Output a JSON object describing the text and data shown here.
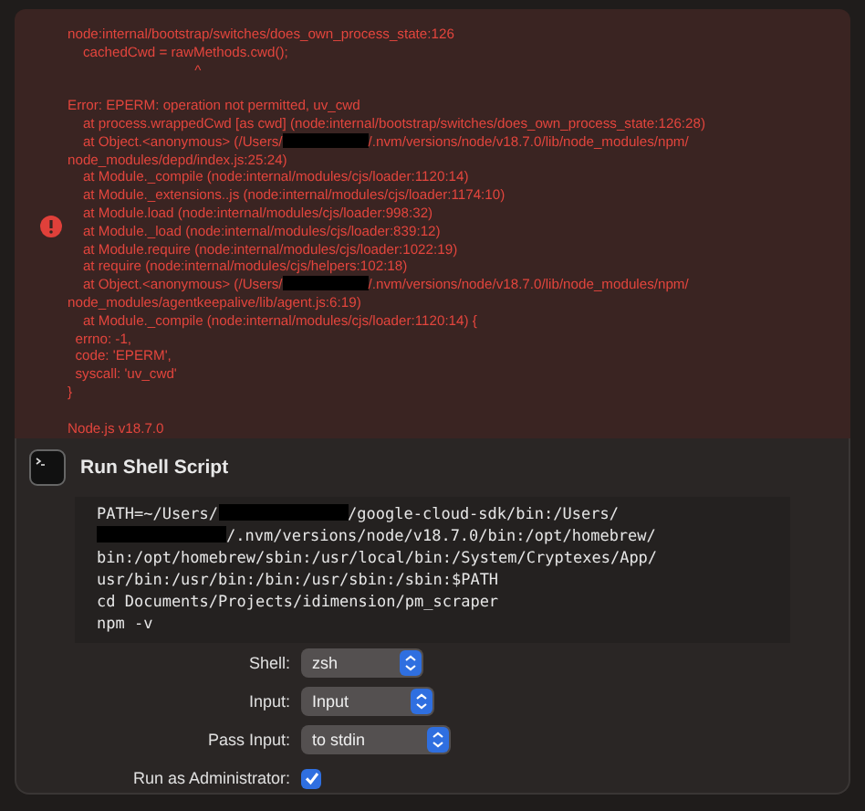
{
  "error_output": {
    "lines": [
      {
        "kind": "text",
        "parts": [
          {
            "kind": "text",
            "text": "node:internal/bootstrap/switches/does_own_process_state:126"
          }
        ]
      },
      {
        "kind": "text",
        "parts": [
          {
            "kind": "text",
            "text": "    cachedCwd = rawMethods.cwd();"
          }
        ]
      },
      {
        "kind": "text",
        "parts": [
          {
            "kind": "text",
            "text": "                                 ^"
          }
        ]
      },
      {
        "kind": "blank"
      },
      {
        "kind": "text",
        "parts": [
          {
            "kind": "text",
            "text": "Error: EPERM: operation not permitted, uv_cwd"
          }
        ]
      },
      {
        "kind": "text",
        "parts": [
          {
            "kind": "text",
            "text": "    at process.wrappedCwd [as cwd] (node:internal/bootstrap/switches/does_own_process_state:126:28)"
          }
        ]
      },
      {
        "kind": "text",
        "parts": [
          {
            "kind": "text",
            "text": "    at Object.<anonymous> (/Users/"
          },
          {
            "kind": "redacted"
          },
          {
            "kind": "text",
            "text": "/.nvm/versions/node/v18.7.0/lib/node_modules/npm/"
          }
        ]
      },
      {
        "kind": "text",
        "parts": [
          {
            "kind": "text",
            "text": "node_modules/depd/index.js:25:24)"
          }
        ]
      },
      {
        "kind": "text",
        "parts": [
          {
            "kind": "text",
            "text": "    at Module._compile (node:internal/modules/cjs/loader:1120:14)"
          }
        ]
      },
      {
        "kind": "text",
        "parts": [
          {
            "kind": "text",
            "text": "    at Module._extensions..js (node:internal/modules/cjs/loader:1174:10)"
          }
        ]
      },
      {
        "kind": "text",
        "parts": [
          {
            "kind": "text",
            "text": "    at Module.load (node:internal/modules/cjs/loader:998:32)"
          }
        ]
      },
      {
        "kind": "text",
        "parts": [
          {
            "kind": "text",
            "text": "    at Module._load (node:internal/modules/cjs/loader:839:12)"
          }
        ]
      },
      {
        "kind": "text",
        "parts": [
          {
            "kind": "text",
            "text": "    at Module.require (node:internal/modules/cjs/loader:1022:19)"
          }
        ]
      },
      {
        "kind": "text",
        "parts": [
          {
            "kind": "text",
            "text": "    at require (node:internal/modules/cjs/helpers:102:18)"
          }
        ]
      },
      {
        "kind": "text",
        "parts": [
          {
            "kind": "text",
            "text": "    at Object.<anonymous> (/Users/"
          },
          {
            "kind": "redacted"
          },
          {
            "kind": "text",
            "text": "/.nvm/versions/node/v18.7.0/lib/node_modules/npm/"
          }
        ]
      },
      {
        "kind": "text",
        "parts": [
          {
            "kind": "text",
            "text": "node_modules/agentkeepalive/lib/agent.js:6:19)"
          }
        ]
      },
      {
        "kind": "text",
        "parts": [
          {
            "kind": "text",
            "text": "    at Module._compile (node:internal/modules/cjs/loader:1120:14) {"
          }
        ]
      },
      {
        "kind": "text",
        "parts": [
          {
            "kind": "text",
            "text": "  errno: -1,"
          }
        ]
      },
      {
        "kind": "text",
        "parts": [
          {
            "kind": "text",
            "text": "  code: 'EPERM',"
          }
        ]
      },
      {
        "kind": "text",
        "parts": [
          {
            "kind": "text",
            "text": "  syscall: 'uv_cwd'"
          }
        ]
      },
      {
        "kind": "text",
        "parts": [
          {
            "kind": "text",
            "text": "}"
          }
        ]
      },
      {
        "kind": "blank"
      },
      {
        "kind": "text",
        "parts": [
          {
            "kind": "text",
            "text": "Node.js v18.7.0"
          }
        ]
      }
    ]
  },
  "action": {
    "title": "Run Shell Script",
    "script_lines": [
      [
        {
          "kind": "text",
          "text": "PATH=~/Users/"
        },
        {
          "kind": "redacted"
        },
        {
          "kind": "text",
          "text": "/google-cloud-sdk/bin:/Users/"
        }
      ],
      [
        {
          "kind": "redacted"
        },
        {
          "kind": "text",
          "text": "/.nvm/versions/node/v18.7.0/bin:/opt/homebrew/"
        }
      ],
      [
        {
          "kind": "text",
          "text": "bin:/opt/homebrew/sbin:/usr/local/bin:/System/Cryptexes/App/"
        }
      ],
      [
        {
          "kind": "text",
          "text": "usr/bin:/usr/bin:/bin:/usr/sbin:/sbin:$PATH"
        }
      ],
      [
        {
          "kind": "text",
          "text": "cd Documents/Projects/idimension/pm_scraper"
        }
      ],
      [
        {
          "kind": "text",
          "text": "npm -v"
        }
      ]
    ],
    "options": [
      {
        "kind": "popup",
        "label": "Shell:",
        "value": "zsh"
      },
      {
        "kind": "popup",
        "label": "Input:",
        "value": "Input"
      },
      {
        "kind": "popup",
        "label": "Pass Input:",
        "value": "to stdin"
      },
      {
        "kind": "checkbox",
        "label": "Run as Administrator:",
        "checked": true
      }
    ]
  }
}
